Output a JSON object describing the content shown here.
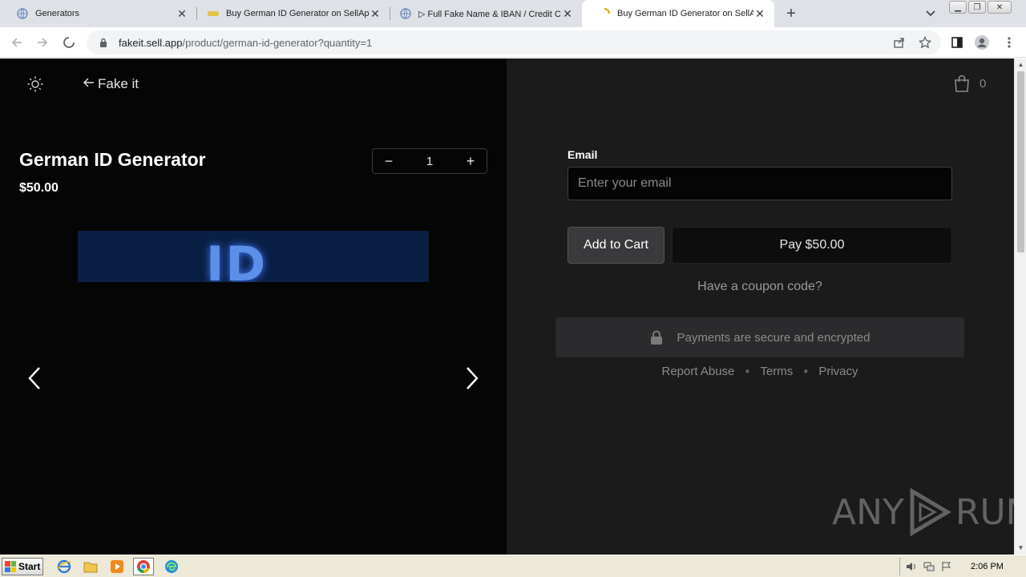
{
  "browser": {
    "tabs": [
      {
        "title": "Generators",
        "icon": "globe-icon",
        "active": false
      },
      {
        "title": "Buy German ID Generator on SellApp",
        "icon": "sellapp-icon",
        "active": false
      },
      {
        "title": "▷ Full Fake Name & IBAN / Credit Card",
        "icon": "globe-icon",
        "active": false
      },
      {
        "title": "Buy German ID Generator on SellApp",
        "icon": "loading-icon",
        "active": true
      }
    ],
    "new_tab": "+",
    "url_host": "fakeit.sell.app",
    "url_path": "/product/german-id-generator?quantity=1"
  },
  "page": {
    "back_label": "Fake it",
    "product_title": "German ID Generator",
    "price": "$50.00",
    "quantity": "1",
    "quantity_minus": "−",
    "quantity_plus": "+",
    "image_glyph": "ID",
    "cart_count": "0",
    "email_label": "Email",
    "email_placeholder": "Enter your email",
    "add_to_cart": "Add to Cart",
    "pay_button": "Pay $50.00",
    "coupon": "Have a coupon code?",
    "secure_text": "Payments are secure and encrypted",
    "footer": [
      "Report Abuse",
      "Terms",
      "Privacy"
    ],
    "watermark_left": "ANY",
    "watermark_right": "RUN"
  },
  "taskbar": {
    "start": "Start",
    "clock": "2:06 PM"
  },
  "colors": {
    "left_bg": "#050505",
    "right_bg": "#1b1b1b",
    "accent_blue": "#5b8fe8"
  }
}
